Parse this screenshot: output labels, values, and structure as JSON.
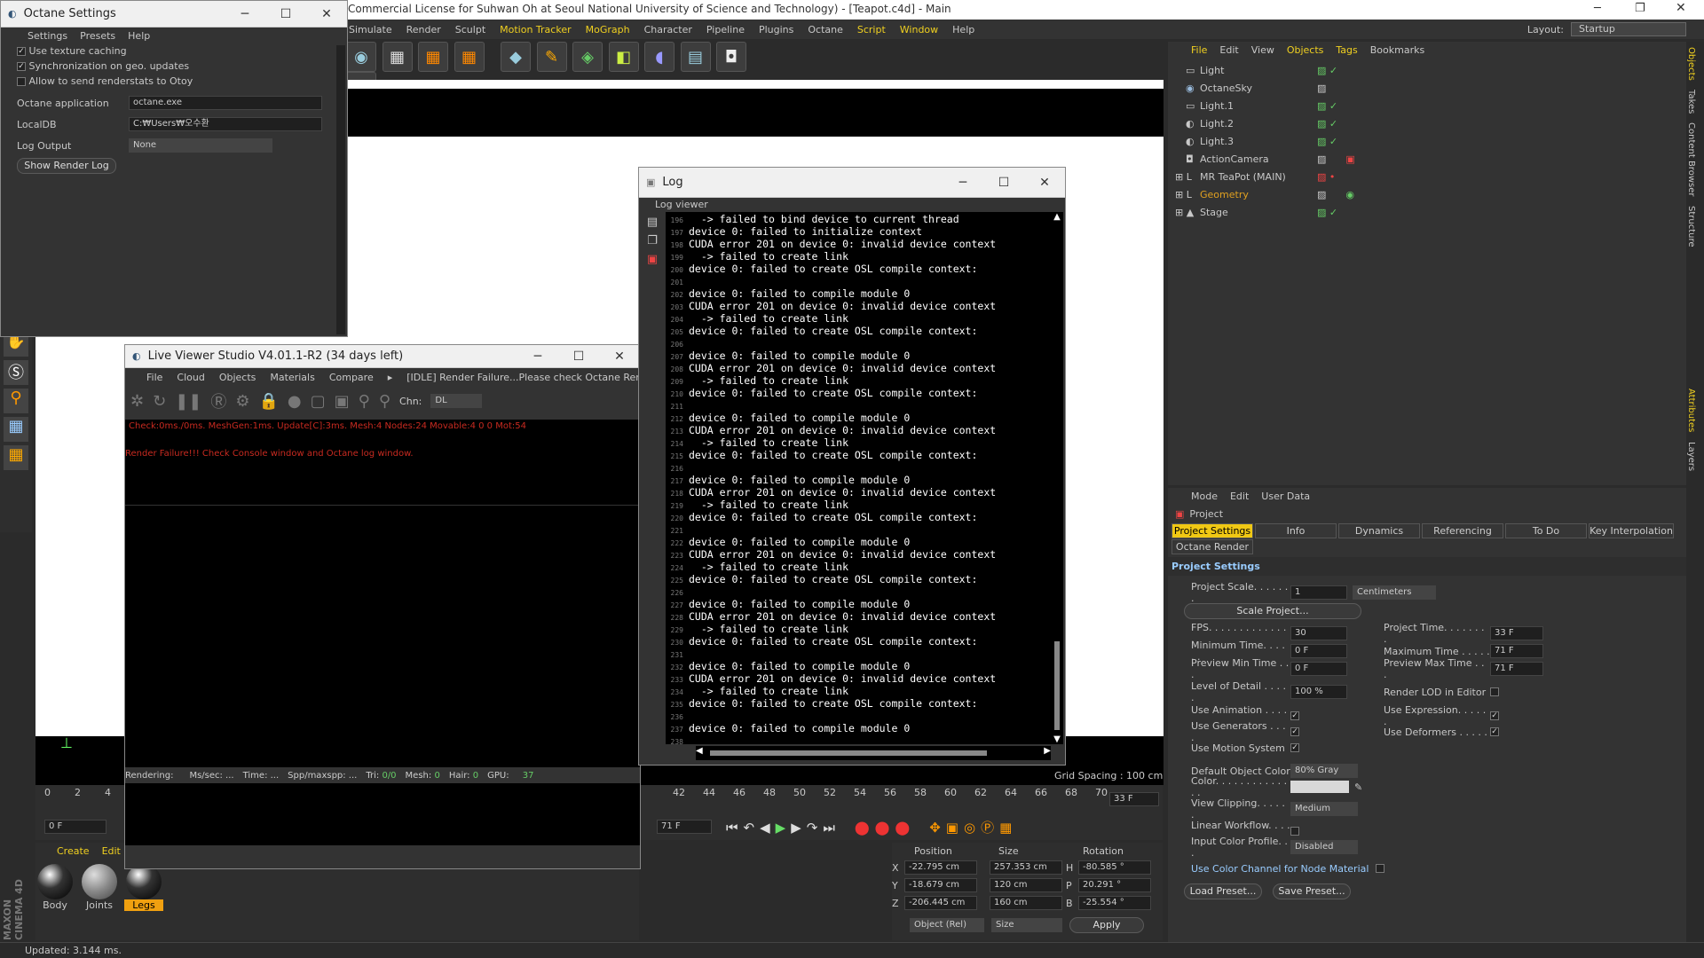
{
  "main": {
    "title": "Commercial License for Suhwan Oh at Seoul National University of Science and Technology) - [Teapot.c4d] - Main",
    "menu": [
      "Simulate",
      "Render",
      "Sculpt",
      "Motion Tracker",
      "MoGraph",
      "Character",
      "Pipeline",
      "Plugins",
      "Octane",
      "Script",
      "Window",
      "Help"
    ],
    "layout_label": "Layout:",
    "layout_value": "Startup"
  },
  "octane_settings": {
    "title": "Octane Settings",
    "menu": [
      "Settings",
      "Presets",
      "Help"
    ],
    "use_texture_caching": "Use texture caching",
    "sync_geo": "Synchronization on geo. updates",
    "allow_stats": "Allow to send renderstats to Otoy",
    "app_label": "Octane application",
    "app_value": "octane.exe",
    "localdb_label": "LocalDB",
    "localdb_value": "C:₩Users₩오수환₩AppData₩Roaming₩O",
    "log_label": "Log Output",
    "log_value": "None",
    "show_log": "Show Render Log"
  },
  "log": {
    "title": "Log",
    "viewer": "Log viewer",
    "lines": [
      {
        "n": "196",
        "t": "  -> failed to bind device to current thread"
      },
      {
        "n": "197",
        "t": "device 0: failed to initialize context"
      },
      {
        "n": "198",
        "t": "CUDA error 201 on device 0: invalid device context"
      },
      {
        "n": "199",
        "t": "  -> failed to create link"
      },
      {
        "n": "200",
        "t": "device 0: failed to create OSL compile context:"
      },
      {
        "n": "201",
        "t": ""
      },
      {
        "n": "202",
        "t": "device 0: failed to compile module 0"
      },
      {
        "n": "203",
        "t": "CUDA error 201 on device 0: invalid device context"
      },
      {
        "n": "204",
        "t": "  -> failed to create link"
      },
      {
        "n": "205",
        "t": "device 0: failed to create OSL compile context:"
      },
      {
        "n": "206",
        "t": ""
      },
      {
        "n": "207",
        "t": "device 0: failed to compile module 0"
      },
      {
        "n": "208",
        "t": "CUDA error 201 on device 0: invalid device context"
      },
      {
        "n": "209",
        "t": "  -> failed to create link"
      },
      {
        "n": "210",
        "t": "device 0: failed to create OSL compile context:"
      },
      {
        "n": "211",
        "t": ""
      },
      {
        "n": "212",
        "t": "device 0: failed to compile module 0"
      },
      {
        "n": "213",
        "t": "CUDA error 201 on device 0: invalid device context"
      },
      {
        "n": "214",
        "t": "  -> failed to create link"
      },
      {
        "n": "215",
        "t": "device 0: failed to create OSL compile context:"
      },
      {
        "n": "216",
        "t": ""
      },
      {
        "n": "217",
        "t": "device 0: failed to compile module 0"
      },
      {
        "n": "218",
        "t": "CUDA error 201 on device 0: invalid device context"
      },
      {
        "n": "219",
        "t": "  -> failed to create link"
      },
      {
        "n": "220",
        "t": "device 0: failed to create OSL compile context:"
      },
      {
        "n": "221",
        "t": ""
      },
      {
        "n": "222",
        "t": "device 0: failed to compile module 0"
      },
      {
        "n": "223",
        "t": "CUDA error 201 on device 0: invalid device context"
      },
      {
        "n": "224",
        "t": "  -> failed to create link"
      },
      {
        "n": "225",
        "t": "device 0: failed to create OSL compile context:"
      },
      {
        "n": "226",
        "t": ""
      },
      {
        "n": "227",
        "t": "device 0: failed to compile module 0"
      },
      {
        "n": "228",
        "t": "CUDA error 201 on device 0: invalid device context"
      },
      {
        "n": "229",
        "t": "  -> failed to create link"
      },
      {
        "n": "230",
        "t": "device 0: failed to create OSL compile context:"
      },
      {
        "n": "231",
        "t": ""
      },
      {
        "n": "232",
        "t": "device 0: failed to compile module 0"
      },
      {
        "n": "233",
        "t": "CUDA error 201 on device 0: invalid device context"
      },
      {
        "n": "234",
        "t": "  -> failed to create link"
      },
      {
        "n": "235",
        "t": "device 0: failed to create OSL compile context:"
      },
      {
        "n": "236",
        "t": ""
      },
      {
        "n": "237",
        "t": "device 0: failed to compile module 0"
      },
      {
        "n": "238",
        "t": ""
      }
    ]
  },
  "live_viewer": {
    "title": "Live Viewer Studio V4.01.1-R2 (34 days left)",
    "menu": [
      "File",
      "Cloud",
      "Objects",
      "Materials",
      "Compare"
    ],
    "status": "[IDLE] Render Failure...Please check Octane Render Log",
    "chn_label": "Chn:",
    "chn_value": "DL",
    "stats": "Check:0ms./0ms. MeshGen:1ms. Update[C]:3ms. Mesh:4 Nodes:24 Movable:4  0 0 Mot:54",
    "error": "Render Failure!!! Check Console window and Octane log window.",
    "bottom": {
      "rendering": "Rendering:",
      "ms": "Ms/sec: ...",
      "time": "Time: ...",
      "spp": "Spp/maxspp: ...",
      "tri_l": "Tri:",
      "tri_v": "0/0",
      "mesh_l": "Mesh:",
      "mesh_v": "0",
      "hair_l": "Hair:",
      "hair_v": "0",
      "gpu": "GPU:",
      "gpu_v": "37"
    }
  },
  "objects": {
    "menu": [
      "File",
      "Edit",
      "View",
      "Objects",
      "Tags",
      "Bookmarks"
    ],
    "items": [
      {
        "name": "Light",
        "color": "#c8c8c8"
      },
      {
        "name": "OctaneSky",
        "color": "#c8c8c8"
      },
      {
        "name": "Light.1",
        "color": "#c8c8c8"
      },
      {
        "name": "Light.2",
        "color": "#c8c8c8"
      },
      {
        "name": "Light.3",
        "color": "#c8c8c8"
      },
      {
        "name": "ActionCamera",
        "color": "#c8c8c8"
      },
      {
        "name": "MR TeaPot (MAIN)",
        "color": "#c8c8c8"
      },
      {
        "name": "Geometry",
        "color": "#e0a020"
      },
      {
        "name": "Stage",
        "color": "#c8c8c8"
      }
    ]
  },
  "attributes": {
    "menu": [
      "Mode",
      "Edit",
      "User Data"
    ],
    "project": "Project",
    "tabs": [
      "Project Settings",
      "Info",
      "Dynamics",
      "Referencing",
      "To Do",
      "Key Interpolation"
    ],
    "tab2": "Octane Render",
    "section": "Project Settings",
    "scale_label": "Project Scale. . . . . . .",
    "scale_value": "1",
    "scale_unit": "Centimeters",
    "scale_btn": "Scale Project...",
    "fps_l": "FPS. . . . . . . . . . . . . .",
    "fps_v": "30",
    "ptime_l": "Project Time. . . . . . . .",
    "ptime_v": "33 F",
    "mint_l": "Minimum Time. . . . . .",
    "mint_v": "0 F",
    "maxt_l": "Maximum Time . . . . .",
    "maxt_v": "71 F",
    "pmin_l": "Preview Min Time . . .",
    "pmin_v": "0 F",
    "pmax_l": "Preview Max Time . . .",
    "pmax_v": "71 F",
    "lod_l": "Level of Detail . . . . .",
    "lod_v": "100 %",
    "lodr_l": "Render LOD in Editor",
    "anim_l": "Use Animation . . . . .",
    "expr_l": "Use Expression. . . . . .",
    "gen_l": "Use Generators . . . .",
    "def_l": "Use Deformers . . . . .",
    "motion_l": "Use Motion System",
    "doc_l": "Default Object Color",
    "doc_v": "80% Gray",
    "color_l": "Color. . . . . . . . . . . . . .",
    "clip_l": "View Clipping. . . . . .",
    "clip_v": "Medium",
    "lw_l": "Linear Workflow. . . . .",
    "icp_l": "Input Color Profile. . .",
    "icp_v": "Disabled",
    "ucc_l": "Use Color Channel for Node Material",
    "load": "Load Preset...",
    "save": "Save Preset..."
  },
  "viewport": {
    "grid": "Grid Spacing : 100 cm"
  },
  "timeline": {
    "ticks": [
      "0",
      "2",
      "4",
      "42",
      "44",
      "46",
      "48",
      "50",
      "52",
      "54",
      "56",
      "58",
      "60",
      "62",
      "64",
      "66",
      "68",
      "70"
    ],
    "current": "33 F",
    "start": "0 F",
    "end": "71 F"
  },
  "materials": {
    "menu": [
      "Create",
      "Edit"
    ],
    "items": [
      "Body",
      "Joints",
      "Legs"
    ]
  },
  "coords": {
    "headers": [
      "Position",
      "Size",
      "Rotation"
    ],
    "rows": [
      {
        "a": "X",
        "p": "-22.795 cm",
        "s": "257.353 cm",
        "r": "H",
        "rv": "-80.585 °"
      },
      {
        "a": "Y",
        "p": "-18.679 cm",
        "s": "120 cm",
        "r": "P",
        "rv": "20.291 °"
      },
      {
        "a": "Z",
        "p": "-206.445 cm",
        "s": "160 cm",
        "r": "B",
        "rv": "-25.554 °"
      }
    ],
    "mode": "Object (Rel)",
    "size": "Size",
    "apply": "Apply"
  },
  "status": "Updated: 3.144 ms.",
  "side_tabs": [
    "Objects",
    "Takes",
    "Content Browser",
    "Structure",
    "Attributes",
    "Layers"
  ]
}
